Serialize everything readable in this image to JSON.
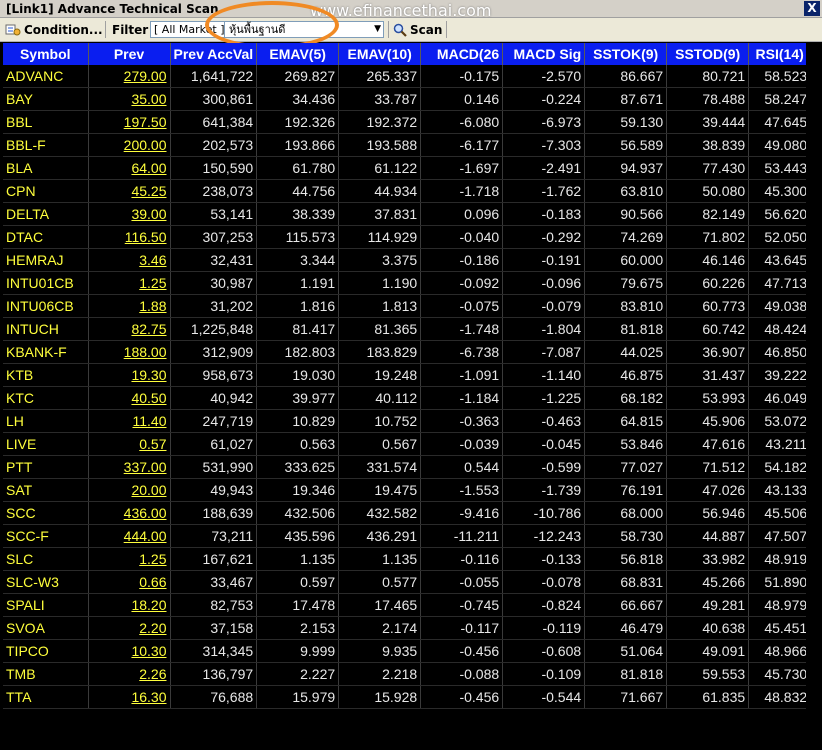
{
  "window": {
    "title": "[Link1] Advance Technical Scan",
    "watermark": "www.efinancethai.com",
    "close_glyph": "X"
  },
  "toolbar": {
    "condition_label": "Condition...",
    "filter_label": "Filter :",
    "filter_value": "[ All Market ]",
    "combo_value": "หุ้นพื้นฐานดี",
    "scan_label": "Scan"
  },
  "table": {
    "columns": [
      "Symbol",
      "Prev",
      "Prev AccVal",
      "EMAV(5)",
      "EMAV(10)",
      "MACD(26",
      "MACD Sig",
      "SSTOK(9)",
      "SSTOD(9)",
      "RSI(14)"
    ],
    "rows": [
      [
        "ADVANC",
        "279.00",
        "1,641,722",
        "269.827",
        "265.337",
        "-0.175",
        "-2.570",
        "86.667",
        "80.721",
        "58.523"
      ],
      [
        "BAY",
        "35.00",
        "300,861",
        "34.436",
        "33.787",
        "0.146",
        "-0.224",
        "87.671",
        "78.488",
        "58.247"
      ],
      [
        "BBL",
        "197.50",
        "641,384",
        "192.326",
        "192.372",
        "-6.080",
        "-6.973",
        "59.130",
        "39.444",
        "47.645"
      ],
      [
        "BBL-F",
        "200.00",
        "202,573",
        "193.866",
        "193.588",
        "-6.177",
        "-7.303",
        "56.589",
        "38.839",
        "49.080"
      ],
      [
        "BLA",
        "64.00",
        "150,590",
        "61.780",
        "61.122",
        "-1.697",
        "-2.491",
        "94.937",
        "77.430",
        "53.443"
      ],
      [
        "CPN",
        "45.25",
        "238,073",
        "44.756",
        "44.934",
        "-1.718",
        "-1.762",
        "63.810",
        "50.080",
        "45.300"
      ],
      [
        "DELTA",
        "39.00",
        "53,141",
        "38.339",
        "37.831",
        "0.096",
        "-0.183",
        "90.566",
        "82.149",
        "56.620"
      ],
      [
        "DTAC",
        "116.50",
        "307,253",
        "115.573",
        "114.929",
        "-0.040",
        "-0.292",
        "74.269",
        "71.802",
        "52.050"
      ],
      [
        "HEMRAJ",
        "3.46",
        "32,431",
        "3.344",
        "3.375",
        "-0.186",
        "-0.191",
        "60.000",
        "46.146",
        "43.645"
      ],
      [
        "INTU01CB",
        "1.25",
        "30,987",
        "1.191",
        "1.190",
        "-0.092",
        "-0.096",
        "79.675",
        "60.226",
        "47.713"
      ],
      [
        "INTU06CB",
        "1.88",
        "31,202",
        "1.816",
        "1.813",
        "-0.075",
        "-0.079",
        "83.810",
        "60.773",
        "49.038"
      ],
      [
        "INTUCH",
        "82.75",
        "1,225,848",
        "81.417",
        "81.365",
        "-1.748",
        "-1.804",
        "81.818",
        "60.742",
        "48.424"
      ],
      [
        "KBANK-F",
        "188.00",
        "312,909",
        "182.803",
        "183.829",
        "-6.738",
        "-7.087",
        "44.025",
        "36.907",
        "46.850"
      ],
      [
        "KTB",
        "19.30",
        "958,673",
        "19.030",
        "19.248",
        "-1.091",
        "-1.140",
        "46.875",
        "31.437",
        "39.222"
      ],
      [
        "KTC",
        "40.50",
        "40,942",
        "39.977",
        "40.112",
        "-1.184",
        "-1.225",
        "68.182",
        "53.993",
        "46.049"
      ],
      [
        "LH",
        "11.40",
        "247,719",
        "10.829",
        "10.752",
        "-0.363",
        "-0.463",
        "64.815",
        "45.906",
        "53.072"
      ],
      [
        "LIVE",
        "0.57",
        "61,027",
        "0.563",
        "0.567",
        "-0.039",
        "-0.045",
        "53.846",
        "47.616",
        "43.211"
      ],
      [
        "PTT",
        "337.00",
        "531,990",
        "333.625",
        "331.574",
        "0.544",
        "-0.599",
        "77.027",
        "71.512",
        "54.182"
      ],
      [
        "SAT",
        "20.00",
        "49,943",
        "19.346",
        "19.475",
        "-1.553",
        "-1.739",
        "76.191",
        "47.026",
        "43.133"
      ],
      [
        "SCC",
        "436.00",
        "188,639",
        "432.506",
        "432.582",
        "-9.416",
        "-10.786",
        "68.000",
        "56.946",
        "45.506"
      ],
      [
        "SCC-F",
        "444.00",
        "73,211",
        "435.596",
        "436.291",
        "-11.211",
        "-12.243",
        "58.730",
        "44.887",
        "47.507"
      ],
      [
        "SLC",
        "1.25",
        "167,621",
        "1.135",
        "1.135",
        "-0.116",
        "-0.133",
        "56.818",
        "33.982",
        "48.919"
      ],
      [
        "SLC-W3",
        "0.66",
        "33,467",
        "0.597",
        "0.577",
        "-0.055",
        "-0.078",
        "68.831",
        "45.266",
        "51.890"
      ],
      [
        "SPALI",
        "18.20",
        "82,753",
        "17.478",
        "17.465",
        "-0.745",
        "-0.824",
        "66.667",
        "49.281",
        "48.979"
      ],
      [
        "SVOA",
        "2.20",
        "37,158",
        "2.153",
        "2.174",
        "-0.117",
        "-0.119",
        "46.479",
        "40.638",
        "45.451"
      ],
      [
        "TIPCO",
        "10.30",
        "314,345",
        "9.999",
        "9.935",
        "-0.456",
        "-0.608",
        "51.064",
        "49.091",
        "48.966"
      ],
      [
        "TMB",
        "2.26",
        "136,797",
        "2.227",
        "2.218",
        "-0.088",
        "-0.109",
        "81.818",
        "59.553",
        "45.730"
      ],
      [
        "TTA",
        "16.30",
        "76,688",
        "15.979",
        "15.928",
        "-0.456",
        "-0.544",
        "71.667",
        "61.835",
        "48.832"
      ]
    ]
  },
  "colors": {
    "header_bg": "#0a1ef0",
    "symbol_text": "#ffff3c",
    "cell_text": "#e8e8e8",
    "grid_bg": "#000000",
    "highlight_oval": "#f08a24"
  }
}
